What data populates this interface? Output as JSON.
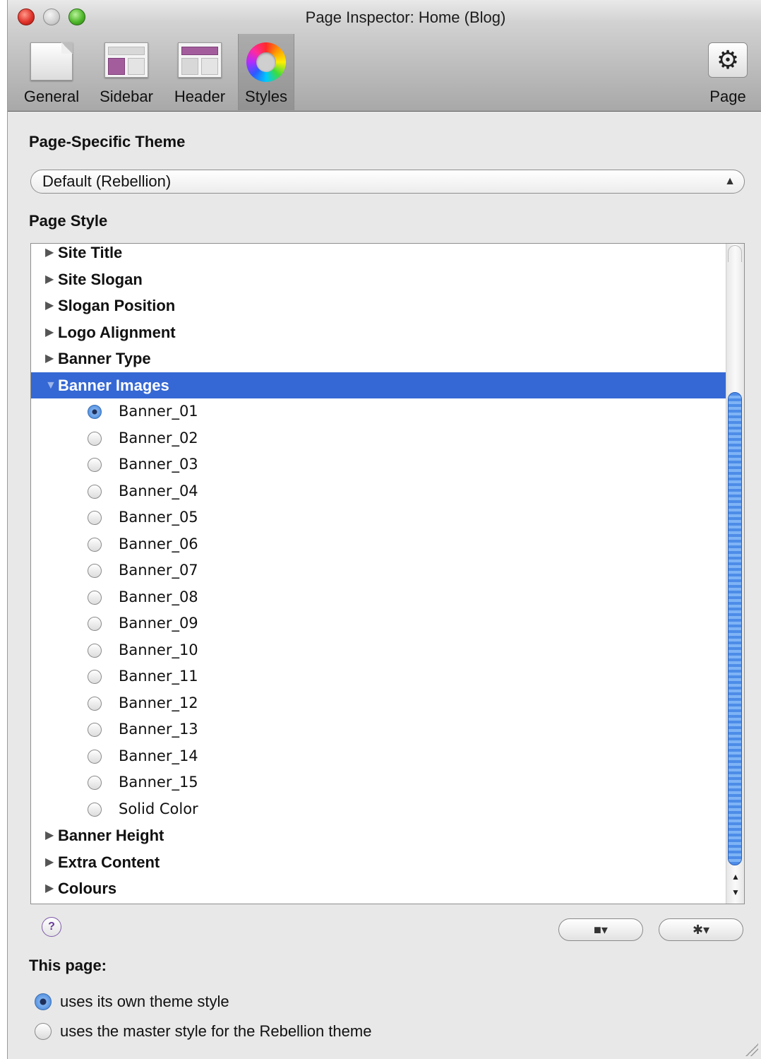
{
  "window": {
    "title": "Page Inspector: Home (Blog)"
  },
  "toolbar": {
    "items": [
      {
        "label": "General",
        "icon": "document-icon"
      },
      {
        "label": "Sidebar",
        "icon": "sidebar-layout-icon"
      },
      {
        "label": "Header",
        "icon": "header-layout-icon"
      },
      {
        "label": "Styles",
        "icon": "color-wheel-icon",
        "selected": true
      }
    ],
    "page": {
      "label": "Page",
      "icon": "gear-icon"
    }
  },
  "theme": {
    "heading": "Page-Specific Theme",
    "selected": "Default (Rebellion)"
  },
  "page_style": {
    "heading": "Page Style",
    "groups_before": [
      "Site Title",
      "Site Slogan",
      "Slogan Position",
      "Logo Alignment",
      "Banner Type"
    ],
    "expanded_group": "Banner Images",
    "banner_images": [
      "Banner_01",
      "Banner_02",
      "Banner_03",
      "Banner_04",
      "Banner_05",
      "Banner_06",
      "Banner_07",
      "Banner_08",
      "Banner_09",
      "Banner_10",
      "Banner_11",
      "Banner_12",
      "Banner_13",
      "Banner_14",
      "Banner_15",
      "Solid Color"
    ],
    "selected_banner": "Banner_01",
    "groups_after": [
      "Banner Height",
      "Extra Content",
      "Colours"
    ]
  },
  "footer": {
    "help_label": "?",
    "folder_button_label": "■▾",
    "gear_button_label": "✱▾"
  },
  "this_page": {
    "heading": "This page:",
    "options": [
      "uses its own theme style",
      "uses the master style for the Rebellion theme"
    ],
    "selected_index": 0
  },
  "colors": {
    "selection": "#3568d4",
    "scroll_thumb": "#4d8ce8"
  }
}
